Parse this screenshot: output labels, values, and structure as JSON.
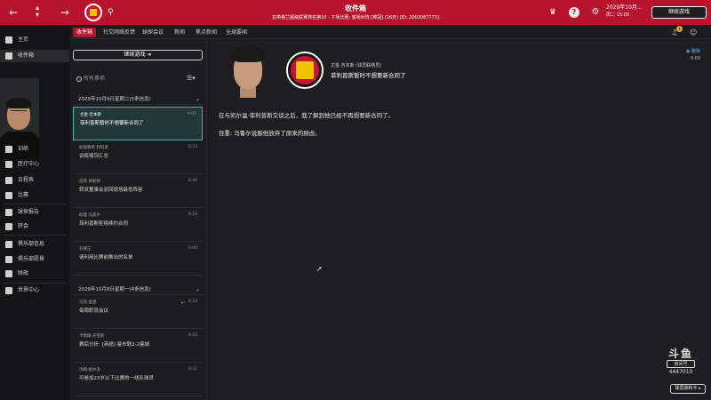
{
  "header": {
    "title": "收件箱",
    "subtitle": "在英格兰超级联赛排名第10 - 下场比赛: 客场对阵 [英冠] (16天) [ID: 2002087773]",
    "date_line1": "2029年10月...",
    "date_line2": "周二 15:00",
    "continue_label": "继续游戏",
    "help_glyph": "?"
  },
  "subtabs": [
    {
      "label": "收件箱",
      "active": true
    },
    {
      "label": "社交网络反馈"
    },
    {
      "label": "球探会议"
    },
    {
      "label": "新闻"
    },
    {
      "label": "焦点新闻"
    },
    {
      "label": "全球要闻"
    }
  ],
  "sidebar": {
    "items": [
      {
        "label": "主页"
      },
      {
        "label": "收件箱"
      },
      {
        "label": "训练"
      },
      {
        "label": "医疗中心"
      },
      {
        "label": "日程表"
      },
      {
        "label": "比赛"
      },
      {
        "label": "球探报告"
      },
      {
        "label": "转会"
      },
      {
        "label": "俱乐部信息"
      },
      {
        "label": "俱乐部愿景"
      },
      {
        "label": "财政"
      },
      {
        "label": "世界中心"
      }
    ]
  },
  "inbox": {
    "continue_label": "继续游戏",
    "search_placeholder": "所有事项",
    "filter_glyph": "☰",
    "groups": [
      {
        "label": "2029年10月9日星期二(5条信息)"
      },
      {
        "label": "2029年10月8日星期一(4条信息)"
      }
    ],
    "messages": [
      {
        "from": "尤金·吉本斯",
        "time": "9:00",
        "subject": "菲利普斯暂时不想要新合同了"
      },
      {
        "from": "助理教练 利科斯",
        "time": "8:33",
        "subject": "训练情况汇总"
      },
      {
        "from": "首席 休斯顿",
        "time": "8:46",
        "subject": "转发董事会驳回退场最低阵容"
      },
      {
        "from": "助理 马盖尔",
        "time": "8:24",
        "subject": "菲利普斯拒绝续约合同"
      },
      {
        "from": "刘德王",
        "time": "0:00",
        "subject": "请利用比赛前推出的名单"
      },
      {
        "from": "马克·金基",
        "time": "8:33",
        "subject": "每周职员会议"
      },
      {
        "from": "卡勒姆·史密斯",
        "time": "8:32",
        "subject": "赛后分析: [英超] 曼市联2-2曼城"
      },
      {
        "from": "汤姆·帕尔多",
        "time": "8:32",
        "subject": "可参加23岁以下比赛的一线队球员"
      }
    ]
  },
  "viewer": {
    "sender": "尤金·吉本斯 (球员联络员)",
    "subject": "菲利普斯暂时不想要新合同了",
    "action_label": "删除",
    "action_time": "9:00",
    "body_lines": [
      "在与凯尔温·菲利普斯交谈之后，我了解到他已经不再想要新合同了。",
      "铨重: 马鲁尔说服他放弃了原来的顾虑。"
    ]
  },
  "watermark": {
    "logo": "斗鱼",
    "room_label": "房间号",
    "room_number": "4447010"
  },
  "bottom_button": "球员资料卡",
  "notifications": {
    "count": "1"
  },
  "colors": {
    "brand_red": "#b8132c",
    "accent_teal": "#3fb7a7",
    "crest_yellow": "#f2c300"
  },
  "icons": [
    "back-arrow-icon",
    "menu-icon",
    "forward-arrow-icon",
    "search-icon",
    "question-icon",
    "settings-icon",
    "bell-icon",
    "chat-icon",
    "home-icon",
    "inbox-icon"
  ]
}
